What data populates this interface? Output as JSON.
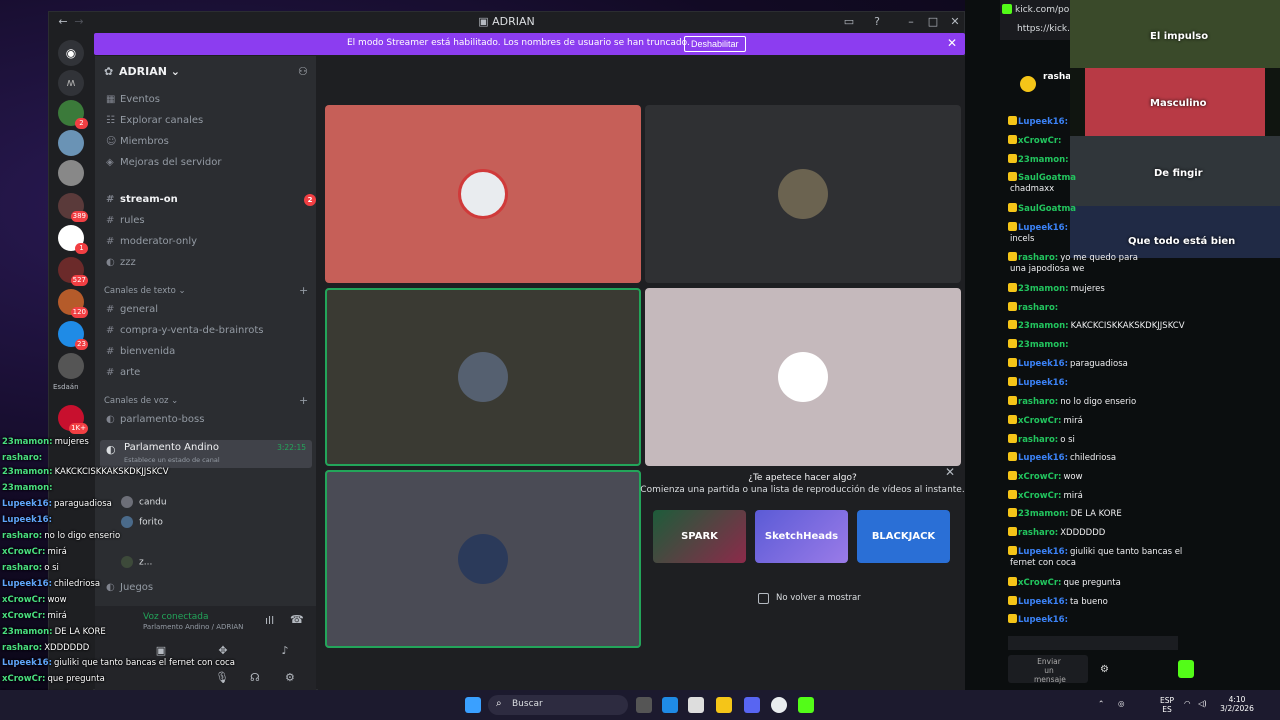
{
  "discord": {
    "window_title": "ADRIAN",
    "banner": {
      "text": "El modo Streamer está habilitado. Los nombres de usuario se han truncado.",
      "button": "Deshabilitar"
    },
    "guild_badges": [
      "2",
      "389",
      "1",
      "527",
      "120",
      "23",
      "1K+"
    ],
    "guild_label": "Esdaán",
    "server_name": "ADRIAN",
    "menu": [
      "Eventos",
      "Explorar canales",
      "Miembros",
      "Mejoras del servidor"
    ],
    "top_channels": [
      {
        "name": "stream-on",
        "badge": "2"
      },
      {
        "name": "rules"
      },
      {
        "name": "moderator-only"
      },
      {
        "name": "zzz"
      }
    ],
    "text_category": "Canales de texto",
    "text_channels": [
      "general",
      "compra-y-venta-de-brainrots",
      "bienvenida",
      "arte"
    ],
    "voice_category": "Canales de voz",
    "voice_channels": [
      "parlamento-boss"
    ],
    "active_voice": {
      "name": "Parlamento Andino",
      "status": "Establece un estado de canal",
      "time": "3:22:15"
    },
    "voice_users": [
      "candu",
      "forito",
      "z..."
    ],
    "voice_other": "Juegos",
    "voice_connected": "Voz conectada",
    "voice_connected_sub": "Parlamento Andino / ADRIAN",
    "promo": {
      "title": "¿Te apetece hacer algo?",
      "subtitle": "Comienza una partida o una lista de reproducción de vídeos al instante.",
      "games": [
        "SPARK",
        "SketchHeads",
        "BLACKJACK"
      ],
      "checkbox_label": "No volver a mostrar"
    }
  },
  "browser": {
    "tab_title": "kick.com/popo",
    "url": "https://kick.co",
    "streamer": "rashar"
  },
  "stream_captions": [
    "El impulso",
    "Masculino",
    "De fingir",
    "Que todo está bien"
  ],
  "kick_chat": [
    {
      "user": "Lupeek16:",
      "text": "",
      "color": "#3b82f6"
    },
    {
      "user": "xCrowCr:",
      "text": "",
      "color": "#22c55e"
    },
    {
      "user": "23mamon:",
      "text": "",
      "color": "#22c55e"
    },
    {
      "user": "SaulGoatma",
      "text": "",
      "color": "#22c55e"
    },
    {
      "user": "",
      "text": "chadmaxx",
      "color": "#ffffff"
    },
    {
      "user": "SaulGoatma",
      "text": "",
      "color": "#22c55e"
    },
    {
      "user": "Lupeek16:",
      "text": "",
      "color": "#3b82f6"
    },
    {
      "user": "",
      "text": "incels",
      "color": "#ffffff"
    },
    {
      "user": "rasharo:",
      "text": "yo me quedo para",
      "color": "#22c55e"
    },
    {
      "user": "",
      "text": "una japodiosa we",
      "color": "#ffffff"
    },
    {
      "user": "23mamon:",
      "text": "mujeres",
      "color": "#22c55e"
    },
    {
      "user": "rasharo:",
      "text": "",
      "color": "#22c55e"
    },
    {
      "user": "23mamon:",
      "text": "KAKCKCISKKAKSKDKJJSKCV",
      "color": "#22c55e"
    },
    {
      "user": "23mamon:",
      "text": "",
      "color": "#22c55e"
    },
    {
      "user": "Lupeek16:",
      "text": "paraguadiosa",
      "color": "#3b82f6"
    },
    {
      "user": "Lupeek16:",
      "text": "",
      "color": "#3b82f6"
    },
    {
      "user": "rasharo:",
      "text": "no lo digo enserio",
      "color": "#22c55e"
    },
    {
      "user": "xCrowCr:",
      "text": "mirá",
      "color": "#22c55e"
    },
    {
      "user": "rasharo:",
      "text": "o si",
      "color": "#22c55e"
    },
    {
      "user": "Lupeek16:",
      "text": "chiledriosa",
      "color": "#3b82f6"
    },
    {
      "user": "xCrowCr:",
      "text": "wow",
      "color": "#22c55e"
    },
    {
      "user": "xCrowCr:",
      "text": "mirá",
      "color": "#22c55e"
    },
    {
      "user": "23mamon:",
      "text": "DE LA KORE",
      "color": "#22c55e"
    },
    {
      "user": "rasharo:",
      "text": "XDDDDDD",
      "color": "#22c55e"
    },
    {
      "user": "Lupeek16:",
      "text": "giuliki que tanto bancas el",
      "color": "#3b82f6"
    },
    {
      "user": "",
      "text": "fernet con coca",
      "color": "#ffffff"
    },
    {
      "user": "xCrowCr:",
      "text": "que pregunta",
      "color": "#22c55e"
    },
    {
      "user": "Lupeek16:",
      "text": "ta bueno",
      "color": "#3b82f6"
    },
    {
      "user": "Lupeek16:",
      "text": "",
      "color": "#3b82f6"
    }
  ],
  "chat_input": "Enviar un mensaje",
  "overlay_chat": [
    {
      "user": "23mamon:",
      "text": "mujeres"
    },
    {
      "user": "rasharo:",
      "text": ""
    },
    {
      "user": "23mamon:",
      "text": "KAKCKCISKKAKSKDKJJSKCV"
    },
    {
      "user": "23mamon:",
      "text": ""
    },
    {
      "user": "Lupeek16:",
      "text": "paraguadiosa"
    },
    {
      "user": "Lupeek16:",
      "text": ""
    },
    {
      "user": "rasharo:",
      "text": "no lo digo enserio"
    },
    {
      "user": "xCrowCr:",
      "text": "mirá"
    },
    {
      "user": "rasharo:",
      "text": "o si"
    },
    {
      "user": "Lupeek16:",
      "text": "chiledriosa"
    },
    {
      "user": "xCrowCr:",
      "text": "wow"
    },
    {
      "user": "xCrowCr:",
      "text": "mirá"
    },
    {
      "user": "23mamon:",
      "text": "DE LA KORE"
    },
    {
      "user": "rasharo:",
      "text": "XDDDDDD"
    },
    {
      "user": "Lupeek16:",
      "text": "giuliki que tanto bancas el fernet con coca"
    },
    {
      "user": "xCrowCr:",
      "text": "que pregunta"
    },
    {
      "user": "Lupeek16:",
      "text": "ta bueno"
    },
    {
      "user": "Lupeek16:",
      "text": ""
    }
  ],
  "taskbar": {
    "search": "Buscar",
    "lang": "ESP",
    "lang2": "ES",
    "time": "4:10",
    "date": "3/2/2026"
  }
}
